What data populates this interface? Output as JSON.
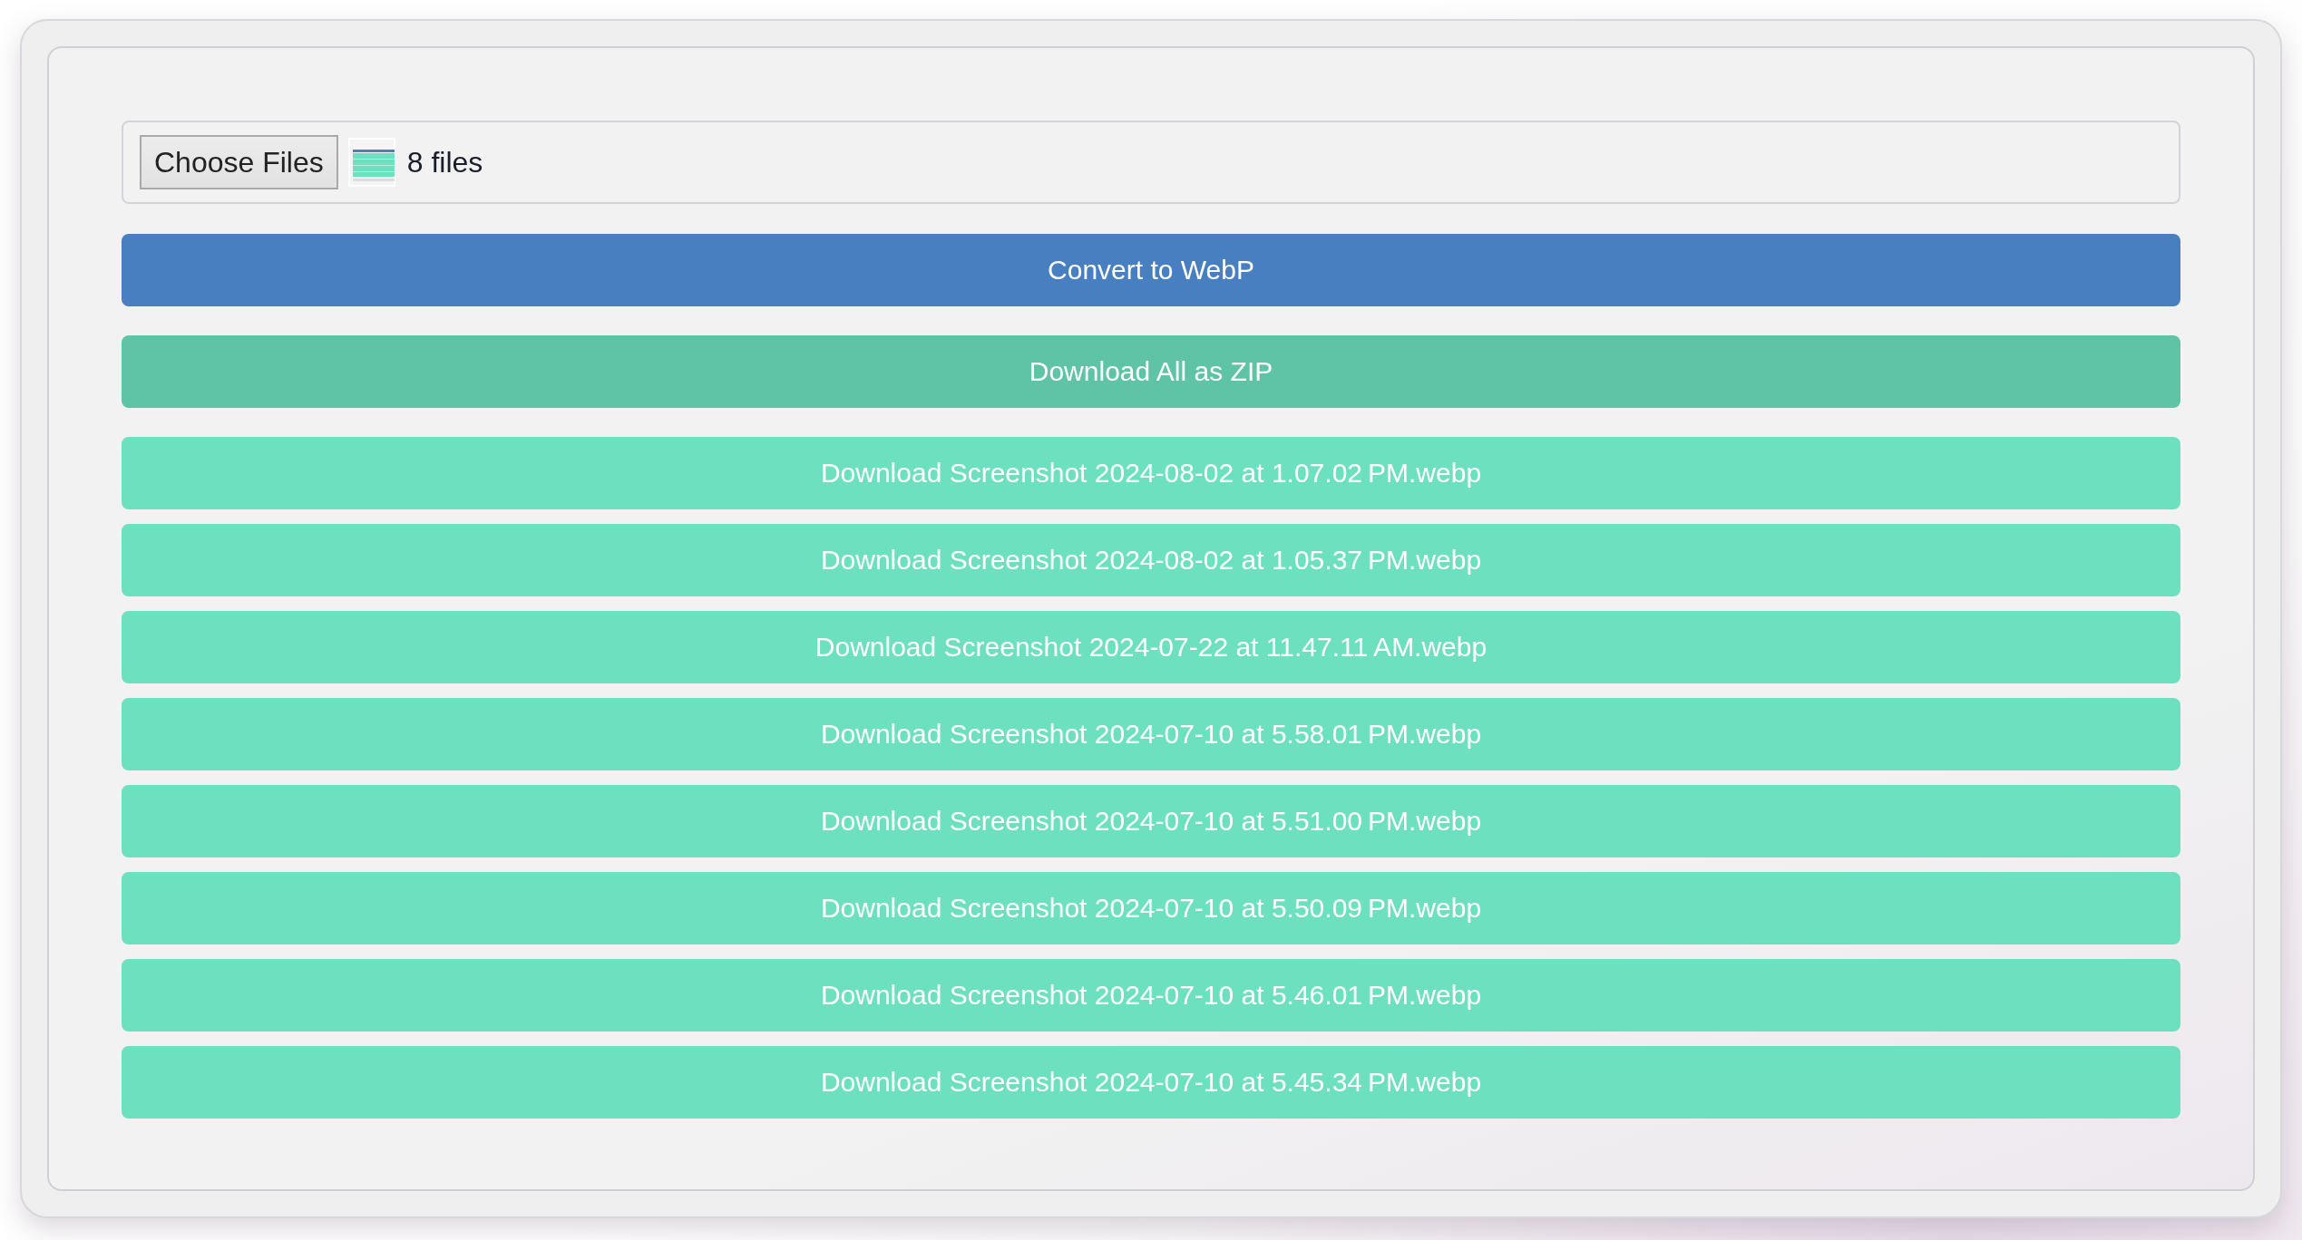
{
  "file_input": {
    "button": "Choose Files",
    "status": "8 files"
  },
  "buttons": [
    {
      "kind": "convert",
      "label": "Convert to WebP"
    },
    {
      "kind": "zip",
      "label": "Download All as ZIP"
    },
    {
      "kind": "download",
      "label": "Download Screenshot 2024-08-02 at 1.07.02 PM.webp"
    },
    {
      "kind": "download",
      "label": "Download Screenshot 2024-08-02 at 1.05.37 PM.webp"
    },
    {
      "kind": "download",
      "label": "Download Screenshot 2024-07-22 at 11.47.11 AM.webp"
    },
    {
      "kind": "download",
      "label": "Download Screenshot 2024-07-10 at 5.58.01 PM.webp"
    },
    {
      "kind": "download",
      "label": "Download Screenshot 2024-07-10 at 5.51.00 PM.webp"
    },
    {
      "kind": "download",
      "label": "Download Screenshot 2024-07-10 at 5.50.09 PM.webp"
    },
    {
      "kind": "download",
      "label": "Download Screenshot 2024-07-10 at 5.46.01 PM.webp"
    },
    {
      "kind": "download",
      "label": "Download Screenshot 2024-07-10 at 5.45.34 PM.webp"
    }
  ]
}
